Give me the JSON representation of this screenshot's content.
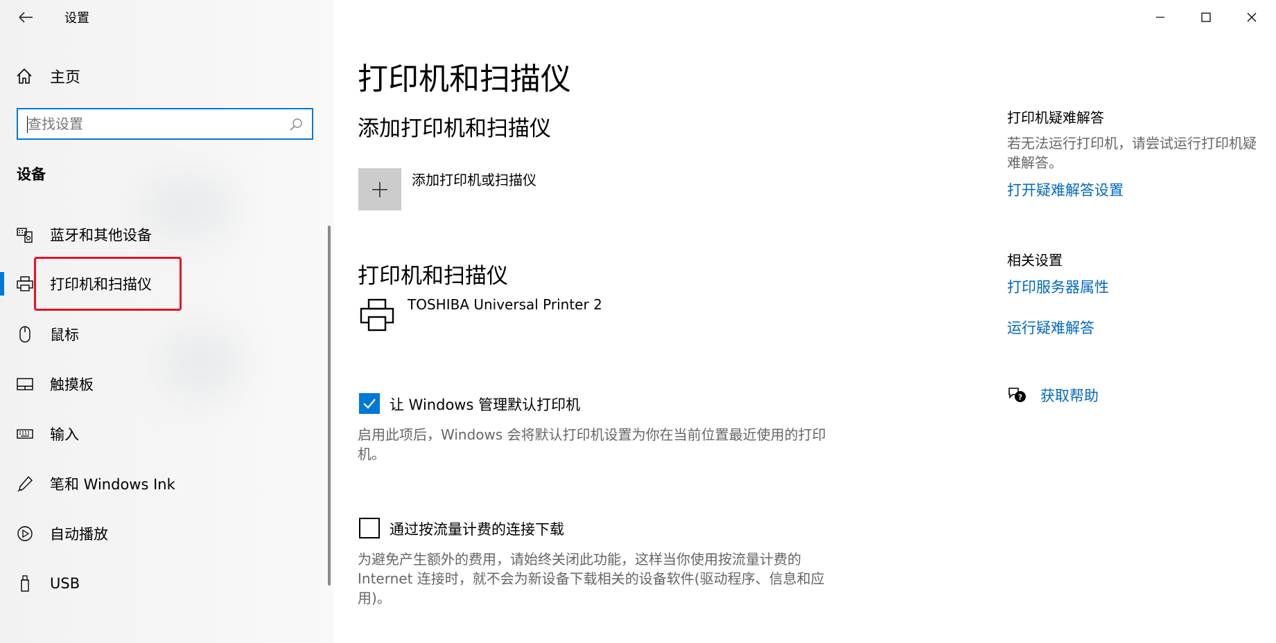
{
  "window": {
    "title": "设置",
    "controls": [
      "minimize",
      "maximize",
      "close"
    ]
  },
  "sidebar": {
    "home_label": "主页",
    "search_placeholder": "查找设置",
    "section_title": "设备",
    "selected_index": 1,
    "items": [
      {
        "label": "蓝牙和其他设备",
        "icon": "bluetooth-devices-icon"
      },
      {
        "label": "打印机和扫描仪",
        "icon": "printer-icon"
      },
      {
        "label": "鼠标",
        "icon": "mouse-icon"
      },
      {
        "label": "触摸板",
        "icon": "touchpad-icon"
      },
      {
        "label": "输入",
        "icon": "keyboard-icon"
      },
      {
        "label": "笔和 Windows Ink",
        "icon": "pen-icon"
      },
      {
        "label": "自动播放",
        "icon": "autoplay-icon"
      },
      {
        "label": "USB",
        "icon": "usb-icon"
      }
    ]
  },
  "main": {
    "page_title": "打印机和扫描仪",
    "add_section": {
      "title": "添加打印机和扫描仪",
      "button_label": "添加打印机或扫描仪"
    },
    "printers_section": {
      "title": "打印机和扫描仪",
      "printers": [
        {
          "name": "TOSHIBA Universal Printer 2"
        }
      ]
    },
    "default_printer": {
      "checked": true,
      "label": "让 Windows 管理默认打印机",
      "description": "启用此项后，Windows 会将默认打印机设置为你在当前位置最近使用的打印机。"
    },
    "metered": {
      "checked": false,
      "label": "通过按流量计费的连接下载",
      "description": "为避免产生额外的费用，请始终关闭此功能，这样当你使用按流量计费的 Internet 连接时，就不会为新设备下载相关的设备软件(驱动程序、信息和应用)。"
    }
  },
  "right": {
    "troubleshoot": {
      "title": "打印机疑难解答",
      "text": "若无法运行打印机，请尝试运行打印机疑难解答。",
      "link": "打开疑难解答设置"
    },
    "related": {
      "title": "相关设置",
      "links": [
        "打印服务器属性",
        "运行疑难解答"
      ]
    },
    "help": {
      "label": "获取帮助"
    }
  },
  "colors": {
    "accent": "#0078d7",
    "link": "#0067c0",
    "highlight_box": "#e81123"
  }
}
